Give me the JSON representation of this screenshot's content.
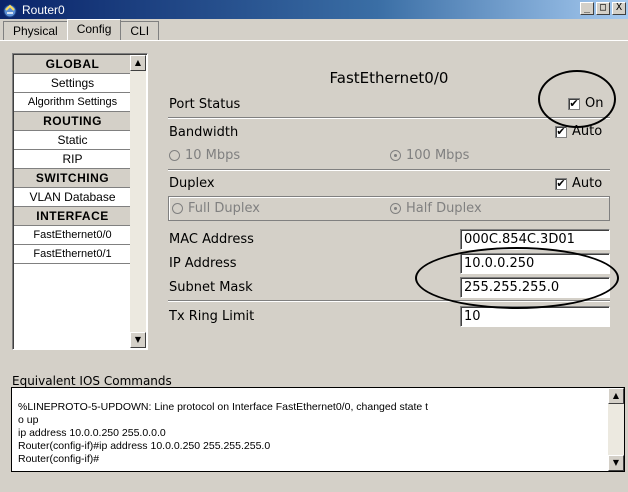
{
  "window": {
    "title": "Router0",
    "minimize": "_",
    "maximize": "□",
    "close": "X"
  },
  "tabs": [
    {
      "label": "Physical"
    },
    {
      "label": "Config"
    },
    {
      "label": "CLI"
    }
  ],
  "nav": {
    "items": [
      {
        "label": "GLOBAL",
        "type": "header"
      },
      {
        "label": "Settings",
        "type": "item"
      },
      {
        "label": "Algorithm Settings",
        "type": "item"
      },
      {
        "label": "ROUTING",
        "type": "header"
      },
      {
        "label": "Static",
        "type": "item"
      },
      {
        "label": "RIP",
        "type": "item"
      },
      {
        "label": "SWITCHING",
        "type": "header"
      },
      {
        "label": "VLAN Database",
        "type": "item"
      },
      {
        "label": "INTERFACE",
        "type": "header"
      },
      {
        "label": "FastEthernet0/0",
        "type": "item"
      },
      {
        "label": "FastEthernet0/1",
        "type": "item"
      }
    ]
  },
  "panel": {
    "title": "FastEthernet0/0",
    "port_status": {
      "label": "Port Status",
      "checkbox_label": "On",
      "checked": true
    },
    "bandwidth": {
      "label": "Bandwidth",
      "auto_label": "Auto",
      "auto_checked": true,
      "opt1": "10 Mbps",
      "opt2": "100 Mbps",
      "selected": "100 Mbps"
    },
    "duplex": {
      "label": "Duplex",
      "auto_label": "Auto",
      "auto_checked": true,
      "opt1": "Full Duplex",
      "opt2": "Half Duplex",
      "selected": "Half Duplex"
    },
    "mac": {
      "label": "MAC Address",
      "value": "000C.854C.3D01"
    },
    "ip": {
      "label": "IP Address",
      "value": "10.0.0.250"
    },
    "mask": {
      "label": "Subnet Mask",
      "value": "255.255.255.0"
    },
    "tx": {
      "label": "Tx Ring Limit",
      "value": "10"
    }
  },
  "ios": {
    "label": "Equivalent IOS Commands",
    "lines": [
      "",
      "%LINEPROTO-5-UPDOWN: Line protocol on Interface FastEthernet0/0, changed state t",
      "o up",
      "ip address 10.0.0.250 255.0.0.0",
      "Router(config-if)#ip address 10.0.0.250 255.255.255.0",
      "Router(config-if)#"
    ]
  },
  "icons": {
    "app": "router-icon",
    "check": "✔"
  },
  "colors": {
    "title_bar_start": "#0a246a",
    "title_bar_end": "#a6caf0",
    "window_bg": "#d4d0c8",
    "annotation_ellipse": "#000000"
  }
}
